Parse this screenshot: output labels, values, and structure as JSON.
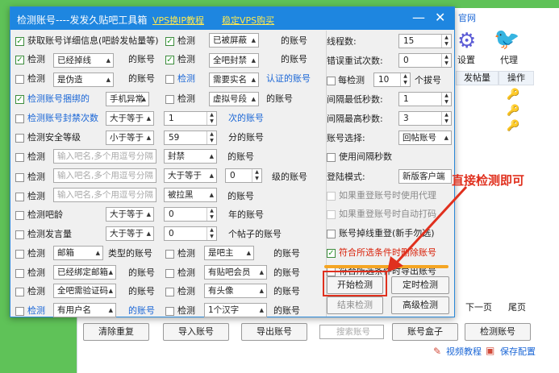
{
  "dialog": {
    "title": "检测账号----发发久贴吧工具箱",
    "link1": "VPS换IP教程",
    "link2": "稳定VPS购买",
    "min": "—",
    "close": "✕"
  },
  "left": {
    "r1": {
      "label": "获取账号详细信息(吧龄发帖量等)",
      "chk": "检测",
      "sel": "已被屏蔽",
      "suffix": "的账号"
    },
    "r2": {
      "chk": "检测",
      "sel": "已经掉线",
      "suffix": "的账号",
      "chk2": "检测",
      "sel2": "全吧封禁",
      "suffix2": "的账号"
    },
    "r3": {
      "chk": "检测",
      "sel": "是伪造",
      "suffix": "的账号",
      "chk2": "检测",
      "sel2": "需要实名",
      "suffix2": "认证的账号"
    },
    "r4": {
      "chk": "检测账号捆绑的",
      "sel": "手机异常",
      "chk2": "检测",
      "sel2": "虚拟号段",
      "suffix2": "的账号"
    },
    "r5": {
      "chk": "检测账号封禁次数",
      "sel": "大于等于",
      "spin": "1",
      "suffix": "次的账号"
    },
    "r6": {
      "chk": "检测安全等级",
      "sel": "小于等于",
      "spin": "59",
      "suffix": "分的账号"
    },
    "r7": {
      "chk": "检测",
      "ph": "输入吧名,多个用逗号分隔",
      "sel": "封禁",
      "suffix": "的账号"
    },
    "r8": {
      "chk": "检测",
      "ph": "输入吧名,多个用逗号分隔",
      "sel": "大于等于",
      "spin": "0",
      "suffix": "级的账号"
    },
    "r9": {
      "chk": "检测",
      "ph": "输入吧名,多个用逗号分隔",
      "sel": "被拉黑",
      "suffix": "的账号"
    },
    "r10": {
      "chk": "检测吧龄",
      "sel": "大于等于",
      "spin": "0",
      "suffix": "年的账号"
    },
    "r11": {
      "chk": "检测发言量",
      "sel": "大于等于",
      "spin": "0",
      "suffix": "个帖子的账号"
    },
    "r12": {
      "chk": "检测",
      "sel": "邮箱",
      "suffix": "类型的账号",
      "chk2": "检测",
      "sel2": "是吧主",
      "suffix2": "的账号"
    },
    "r13": {
      "chk": "检测",
      "sel": "已经绑定邮箱",
      "suffix": "的账号",
      "chk2": "检测",
      "sel2": "有贴吧会员",
      "suffix2": "的账号"
    },
    "r14": {
      "chk": "检测",
      "sel": "全吧需验证码",
      "suffix": "的账号",
      "chk2": "检测",
      "sel2": "有头像",
      "suffix2": "的账号"
    },
    "r15": {
      "chk": "检测",
      "sel": "有用户名",
      "suffix": "的账号",
      "chk2": "检测",
      "sel2": "1个汉字",
      "suffix2": "的账号"
    }
  },
  "right": {
    "threads": "线程数:",
    "threads_val": "15",
    "retry": "错误重试次数:",
    "retry_val": "0",
    "every": "每检测",
    "every_val": "10",
    "every_suffix": "个拔号",
    "min_int": "间隔最低秒数:",
    "min_val": "1",
    "max_int": "间隔最高秒数:",
    "max_val": "3",
    "acct_sel": "账号选择:",
    "acct_sel_val": "回帖账号",
    "use_int": "使用间隔秒数",
    "login": "登陆模式:",
    "login_val": "新版客户端",
    "o1": "如果重登账号时使用代理",
    "o2": "如果重登账号时自动打码",
    "o3": "账号掉线重登(新手勿选)",
    "o4": "符合所选条件时删除账号",
    "o5": "符合所选条件时导出账号",
    "btn_start": "开始检测",
    "btn_timer": "定时检测",
    "btn_end": "结束检测",
    "btn_adv": "高级检测"
  },
  "annotation": "直接检测即可",
  "bg": {
    "official": "官网",
    "settings": "设置",
    "proxy": "代理",
    "col_posts": "发帖量",
    "col_op": "操作",
    "next": "下一页",
    "last": "尾页",
    "buttons": [
      "清除重复",
      "导入账号",
      "导出账号",
      "搜索账号",
      "账号盒子",
      "检测账号"
    ],
    "video": "视频教程",
    "save": "保存配置"
  }
}
